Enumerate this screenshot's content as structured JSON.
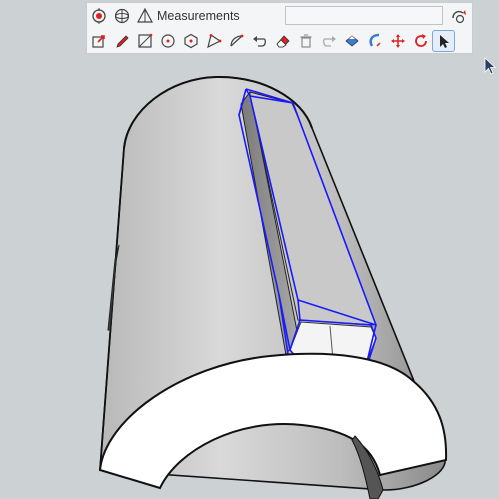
{
  "toolbar": {
    "row1": [
      {
        "name": "select-icon"
      },
      {
        "name": "orbit-icon"
      },
      {
        "name": "tape-measure-icon"
      }
    ],
    "measurements_label": "Measurements",
    "measurements_value": "",
    "help_icon": "instructor-icon",
    "row2": [
      {
        "name": "push-pull-select-icon"
      },
      {
        "name": "pencil-icon"
      },
      {
        "name": "rectangle-icon"
      },
      {
        "name": "circle-icon"
      },
      {
        "name": "polygon-icon"
      },
      {
        "name": "offset-icon"
      },
      {
        "name": "arc-icon"
      },
      {
        "name": "undo-icon"
      },
      {
        "name": "eraser-icon"
      },
      {
        "name": "trash-icon"
      },
      {
        "name": "redo-icon"
      },
      {
        "name": "paint-bucket-icon"
      },
      {
        "name": "follow-me-icon"
      },
      {
        "name": "move-icon"
      },
      {
        "name": "rotate-icon"
      },
      {
        "name": "select-arrow-icon",
        "active": true
      }
    ]
  },
  "colors": {
    "viewport_bg": "#ccd2d4",
    "toolbar_bg": "#f4f5f6",
    "selection": "#1a1aff",
    "solid_face": "#ffffff",
    "curved_face": "#b5b5b5"
  }
}
